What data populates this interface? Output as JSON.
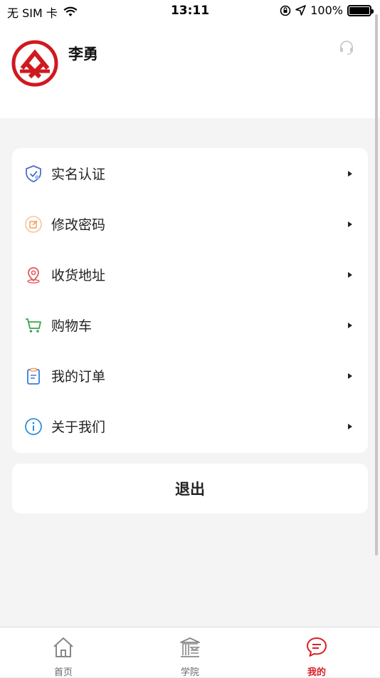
{
  "status_bar": {
    "carrier": "无 SIM 卡",
    "time": "13:11",
    "battery": "100%"
  },
  "profile": {
    "username": "李勇"
  },
  "menu": {
    "items": [
      {
        "label": "实名认证",
        "icon": "shield-check-icon",
        "color": "#4a6fd1"
      },
      {
        "label": "修改密码",
        "icon": "edit-icon",
        "color": "#f0a35e"
      },
      {
        "label": "收货地址",
        "icon": "location-pin-icon",
        "color": "#e05a5a"
      },
      {
        "label": "购物车",
        "icon": "cart-icon",
        "color": "#3aa64a"
      },
      {
        "label": "我的订单",
        "icon": "clipboard-icon",
        "color": "#3b7bd8"
      },
      {
        "label": "关于我们",
        "icon": "info-icon",
        "color": "#2f8fd8"
      }
    ]
  },
  "logout_label": "退出",
  "tabbar": {
    "tabs": [
      {
        "label": "首页",
        "icon": "home-icon",
        "active": false
      },
      {
        "label": "学院",
        "icon": "academy-icon",
        "active": false
      },
      {
        "label": "我的",
        "icon": "chat-bubble-icon",
        "active": true
      }
    ]
  },
  "colors": {
    "accent": "#d92027",
    "background": "#f4f4f4"
  }
}
